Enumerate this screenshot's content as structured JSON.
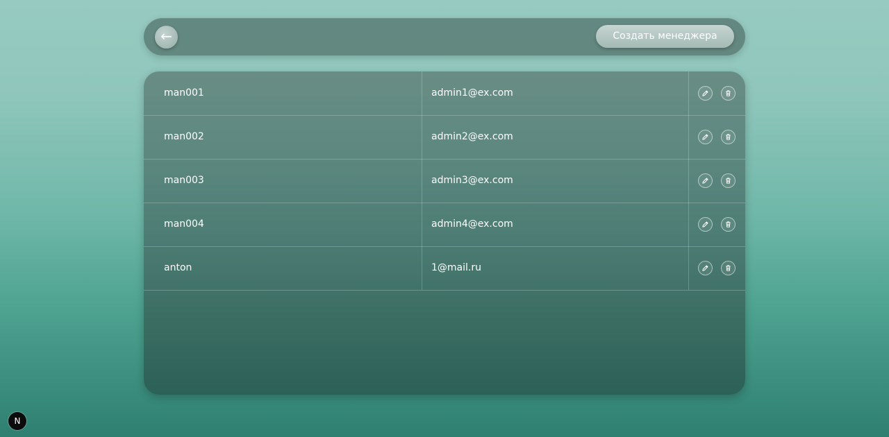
{
  "header": {
    "back_label": "←",
    "create_button_label": "Создать менеджера"
  },
  "table": {
    "rows": [
      {
        "username": "man001",
        "email": "admin1@ex.com"
      },
      {
        "username": "man002",
        "email": "admin2@ex.com"
      },
      {
        "username": "man003",
        "email": "admin3@ex.com"
      },
      {
        "username": "man004",
        "email": "admin4@ex.com"
      },
      {
        "username": "anton",
        "email": "1@mail.ru"
      }
    ],
    "row_actions": [
      "pencil-icon",
      "trash-icon"
    ]
  },
  "badge": {
    "label": "N"
  },
  "colors": {
    "accent": "#5d8880",
    "background_top": "#97cbc1",
    "background_bottom": "#2e7f70"
  }
}
